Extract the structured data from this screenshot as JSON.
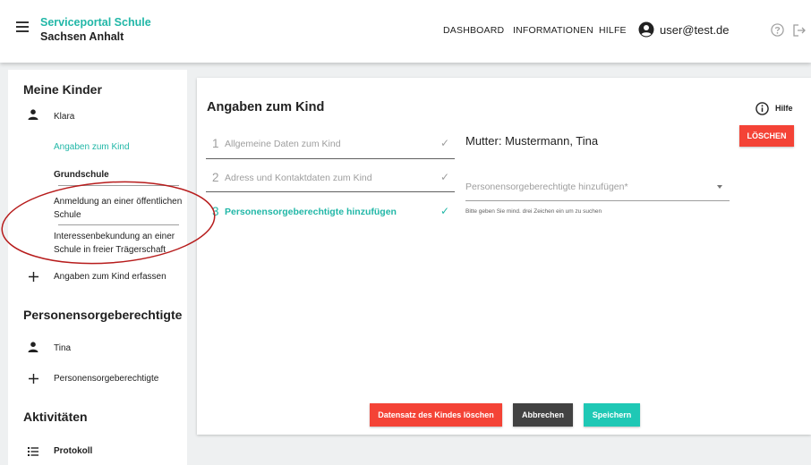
{
  "header": {
    "brand_line1": "Serviceportal Schule",
    "brand_line2": "Sachsen Anhalt",
    "nav": [
      "DASHBOARD",
      "INFORMATIONEN",
      "HILFE"
    ],
    "user_email": "user@test.de"
  },
  "sidebar": {
    "section_children": "Meine Kinder",
    "child_name": "Klara",
    "child_details": "Angaben zum Kind",
    "school_type": "Grundschule",
    "option1_line1": "Anmeldung an einer öffentlichen",
    "option1_line2": "Schule",
    "option2_line1": "Interessenbekundung an einer",
    "option2_line2": "Schule in freier Trägerschaft",
    "add_child": "Angaben zum Kind erfassen",
    "section_guardians": "Personensorgeberechtigte",
    "guardian_name": "Tina",
    "add_guardian": "Personensorgeberechtigte",
    "section_activities": "Aktivitäten",
    "protocol": "Protokoll"
  },
  "main": {
    "title": "Angaben zum Kind",
    "help_label": "Hilfe",
    "delete_label": "LÖSCHEN",
    "steps": [
      {
        "num": "1",
        "label": "Allgemeine Daten zum Kind",
        "check": "✓"
      },
      {
        "num": "2",
        "label": "Adress und Kontaktdaten zum Kind",
        "check": "✓"
      },
      {
        "num": "3",
        "label": "Personensorgeberechtigte hinzufügen",
        "check": "✓"
      }
    ],
    "guardian_label": "Mutter: Mustermann, Tina",
    "select_placeholder": "Personensorgeberechtigte hinzufügen*",
    "select_hint": "Bitte geben Sie mind. drei Zeichen ein um zu suchen",
    "btn_delete_record": "Datensatz des Kindes löschen",
    "btn_cancel": "Abbrechen",
    "btn_save": "Speichern"
  },
  "colors": {
    "accent": "#21b7a7",
    "danger": "#f44336",
    "dark_button": "#424242",
    "save_button": "#1fc8b5",
    "annotation": "#b71c1c"
  }
}
